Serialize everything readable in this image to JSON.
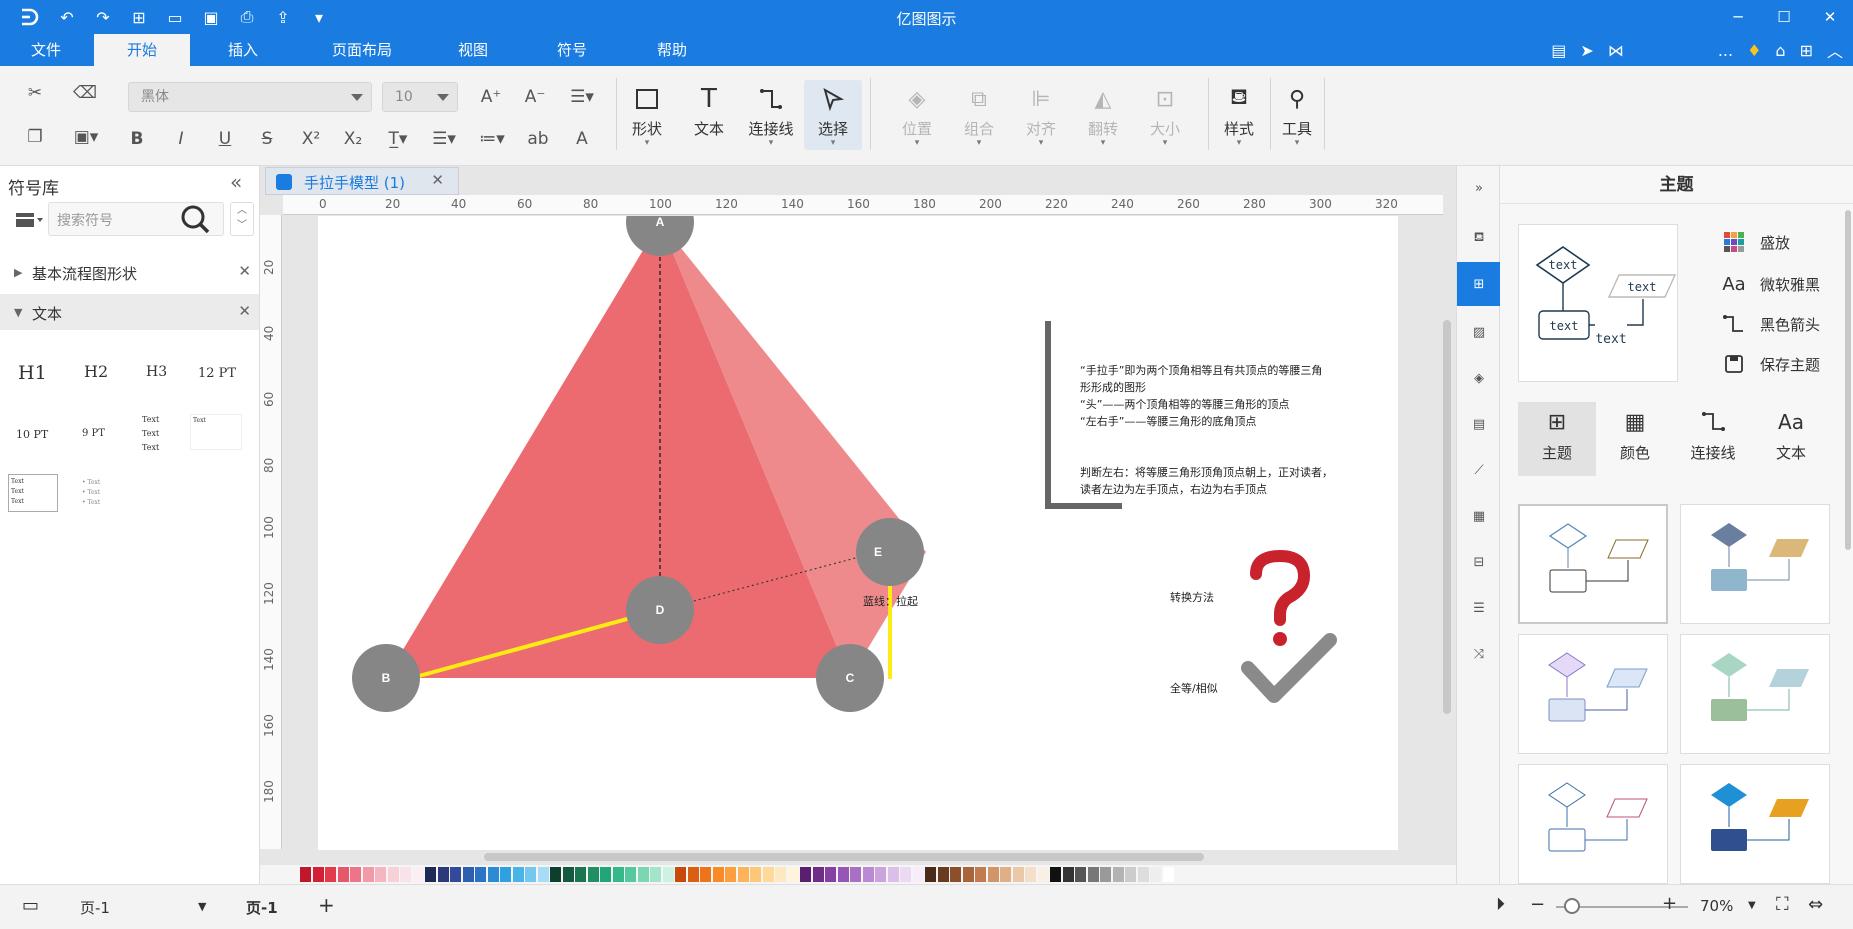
{
  "app": {
    "title": "亿图图示"
  },
  "menu": {
    "tabs": [
      {
        "label": "文件"
      },
      {
        "label": "开始"
      },
      {
        "label": "插入"
      },
      {
        "label": "页面布局"
      },
      {
        "label": "视图"
      },
      {
        "label": "符号"
      },
      {
        "label": "帮助"
      }
    ],
    "more": "..."
  },
  "ribbon": {
    "font_family": "黑体",
    "font_size": "10",
    "buttons": {
      "shape": "形状",
      "text": "文本",
      "connector": "连接线",
      "select": "选择",
      "position": "位置",
      "group": "组合",
      "align": "对齐",
      "flip": "翻转",
      "size": "大小",
      "style": "样式",
      "tools": "工具"
    },
    "format": {
      "bold": "B",
      "italic": "I",
      "underline": "U",
      "strike": "S",
      "sup": "X²",
      "sub": "X₂",
      "abc": "ab",
      "color_a": "A"
    }
  },
  "library": {
    "title": "符号库",
    "search_placeholder": "搜索符号",
    "categories": [
      {
        "label": "基本流程图形状"
      },
      {
        "label": "文本"
      }
    ],
    "text_styles": {
      "h1": "H1",
      "h2": "H2",
      "h3": "H3",
      "pt12": "12 PT",
      "pt10": "10 PT",
      "pt9": "9 PT",
      "text1": "Text",
      "text2": "Text",
      "text3": "Text",
      "text_small": "Text"
    }
  },
  "document": {
    "tab_label": "手拉手模型 (1)",
    "ruler_h": [
      "0",
      "20",
      "40",
      "60",
      "80",
      "100",
      "120",
      "140",
      "160",
      "180",
      "200",
      "220",
      "240",
      "260",
      "280",
      "300",
      "320"
    ],
    "ruler_v": [
      "20",
      "40",
      "60",
      "80",
      "100",
      "120",
      "140",
      "160",
      "180"
    ]
  },
  "diagram": {
    "nodes": {
      "a": "A",
      "b": "B",
      "c": "C",
      "d": "D",
      "e": "E"
    },
    "label_dashed": "蓝线：拉起",
    "notes": [
      "“手拉手”即为两个顶角相等且有共顶点的等腰三角",
      "形形成的图形",
      "“头”——两个顶角相等的等腰三角形的顶点",
      "“左右手”——等腰三角形的底角顶点"
    ],
    "judge": [
      "判断左右：将等腰三角形顶角顶点朝上，正对读者，",
      "读者左边为左手顶点，右边为右手顶点"
    ],
    "convert": "转换方法",
    "congruent": "全等/相似",
    "colors": {
      "triangle": "#ec6b70",
      "triangle_light": "#ee8a8c",
      "node": "#868686",
      "yellow": "#ffeb14"
    }
  },
  "right_panel": {
    "title": "主题",
    "preview_texts": [
      "text",
      "text",
      "text",
      "text"
    ],
    "options": [
      {
        "label": "盛放",
        "icon": "palette-icon"
      },
      {
        "label": "微软雅黑",
        "icon": "font-icon"
      },
      {
        "label": "黑色箭头",
        "icon": "arrow-icon"
      },
      {
        "label": "保存主题",
        "icon": "save-icon"
      }
    ],
    "tabs": [
      {
        "label": "主题"
      },
      {
        "label": "颜色"
      },
      {
        "label": "连接线"
      },
      {
        "label": "文本"
      }
    ]
  },
  "status": {
    "page_select": "页-1",
    "page_tab": "页-1",
    "add": "+",
    "zoom": "70%"
  }
}
